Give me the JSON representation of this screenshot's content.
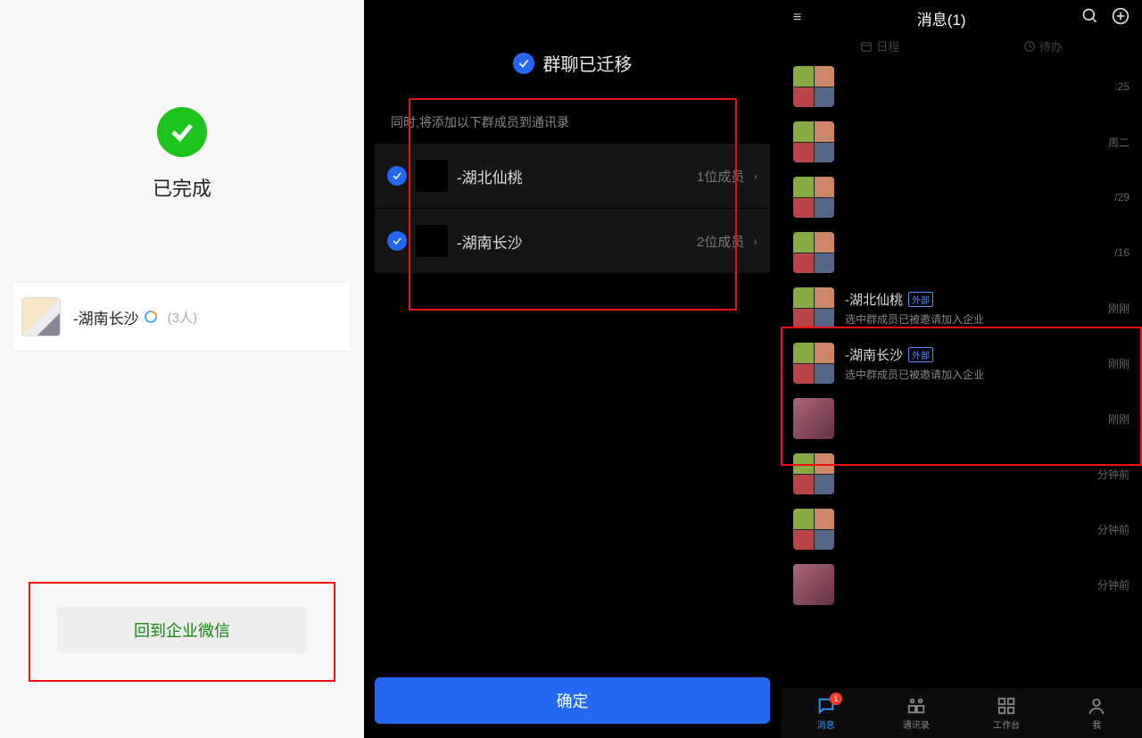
{
  "left": {
    "done": "已完成",
    "group_name": "-湖南长沙",
    "group_members": "(3人)",
    "back_button": "回到企业微信"
  },
  "mid": {
    "title": "群聊已迁移",
    "hint": "同时,将添加以下群成员到通讯录",
    "items": [
      {
        "name": "-湖北仙桃",
        "count": "1位成员"
      },
      {
        "name": "-湖南长沙",
        "count": "2位成员"
      }
    ],
    "confirm": "确定"
  },
  "right": {
    "header_title": "消息(1)",
    "subtabs": {
      "schedule": "日程",
      "todo": "待办"
    },
    "rows": [
      {
        "name": "",
        "time": ":25",
        "sub": "",
        "avatar": "grid"
      },
      {
        "name": "",
        "time": "周二",
        "sub": "",
        "avatar": "grid"
      },
      {
        "name": "",
        "time": "/29",
        "sub": "",
        "avatar": "grid"
      },
      {
        "name": "",
        "time": "/16",
        "sub": "",
        "avatar": "grid"
      },
      {
        "name": "-湖北仙桃",
        "badge": "外部",
        "sub": "选中群成员已被邀请加入企业",
        "time": "刚刚",
        "avatar": "grid"
      },
      {
        "name": "-湖南长沙",
        "badge": "外部",
        "sub": "选中群成员已被邀请加入企业",
        "time": "刚刚",
        "avatar": "grid"
      },
      {
        "name": "",
        "time": "刚刚",
        "sub": "",
        "avatar": "single"
      },
      {
        "name": "",
        "time": "分钟前",
        "sub": "",
        "avatar": "grid"
      },
      {
        "name": "",
        "time": "分钟前",
        "sub": "",
        "avatar": "grid"
      },
      {
        "name": "",
        "time": "分钟前",
        "sub": "",
        "avatar": "single"
      }
    ],
    "tabs": {
      "msg": "消息",
      "contacts": "通讯录",
      "work": "工作台",
      "me": "我"
    },
    "badge_count": "1"
  }
}
